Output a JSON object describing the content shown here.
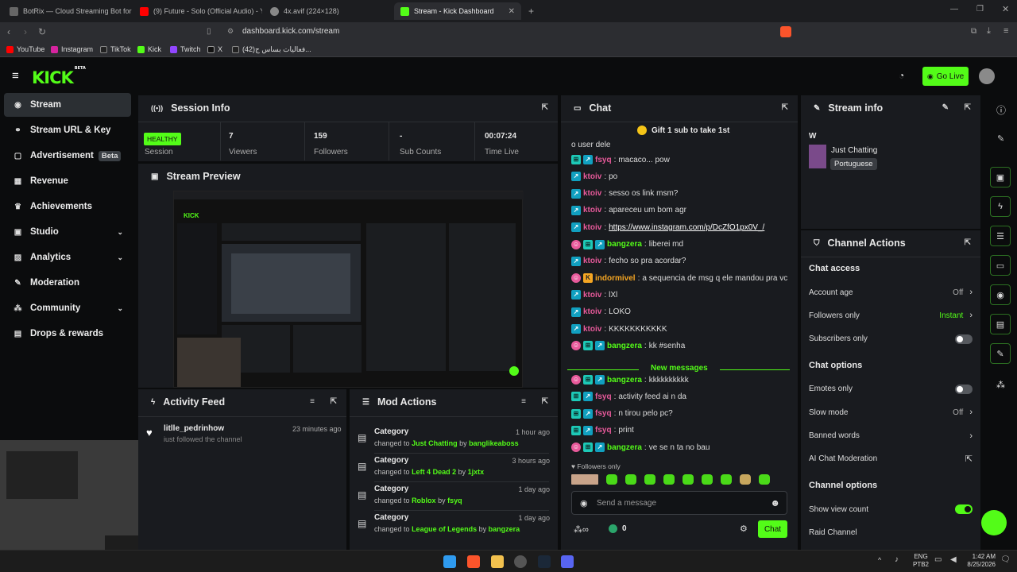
{
  "browser": {
    "tabs": [
      {
        "title": "BotRix — Cloud Streaming Bot for Tw",
        "color": "#666"
      },
      {
        "title": "(9) Future - Solo (Official Audio) - Yo",
        "color": "#ff0000"
      },
      {
        "title": "4x.avif (224×128)",
        "color": "#888"
      },
      {
        "title": "Stream - Kick Dashboard",
        "color": "#53fc18"
      }
    ],
    "url": "dashboard.kick.com/stream",
    "bookmarks": [
      "YouTube",
      "Instagram",
      "TikTok",
      "Kick",
      "Twitch",
      "X",
      "(42)فعاليات بساس ج..."
    ]
  },
  "header": {
    "logo": "KICK",
    "logo_sup": "BETA",
    "go_live": "Go Live"
  },
  "sidebar": {
    "items": [
      {
        "label": "Stream",
        "icon": "broadcast-icon",
        "active": true
      },
      {
        "label": "Stream URL & Key",
        "icon": "link-icon"
      },
      {
        "label": "Advertisement",
        "icon": "ad-icon",
        "badge": "Beta"
      },
      {
        "label": "Revenue",
        "icon": "revenue-icon"
      },
      {
        "label": "Achievements",
        "icon": "trophy-icon"
      },
      {
        "label": "Studio",
        "icon": "studio-icon",
        "chevron": true
      },
      {
        "label": "Analytics",
        "icon": "analytics-icon",
        "chevron": true
      },
      {
        "label": "Moderation",
        "icon": "wrench-icon"
      },
      {
        "label": "Community",
        "icon": "community-icon",
        "chevron": true
      },
      {
        "label": "Drops & rewards",
        "icon": "gift-icon"
      }
    ]
  },
  "session": {
    "title": "Session Info",
    "health": "HEALTHY",
    "stats": [
      {
        "label": "Session",
        "value": ""
      },
      {
        "label": "Viewers",
        "value": "7"
      },
      {
        "label": "Followers",
        "value": "159"
      },
      {
        "label": "Sub Counts",
        "value": "-"
      },
      {
        "label": "Time Live",
        "value": "00:07:24"
      }
    ]
  },
  "preview": {
    "title": "Stream Preview"
  },
  "activity": {
    "title": "Activity Feed",
    "items": [
      {
        "user": "litlle_pedrinhow",
        "time": "23 minutes ago",
        "text": "just followed the channel"
      }
    ]
  },
  "mod_actions": {
    "title": "Mod Actions",
    "items": [
      {
        "title": "Category",
        "time": "1 hour ago",
        "prefix": "changed to",
        "value": "Just Chatting",
        "by": "by",
        "user": "banglikeaboss"
      },
      {
        "title": "Category",
        "time": "3 hours ago",
        "prefix": "changed to",
        "value": "Left 4 Dead 2",
        "by": "by",
        "user": "1jxtx"
      },
      {
        "title": "Category",
        "time": "1 day ago",
        "prefix": "changed to",
        "value": "Roblox",
        "by": "by",
        "user": "fsyq"
      },
      {
        "title": "Category",
        "time": "1 day ago",
        "prefix": "changed to",
        "value": "League of Legends",
        "by": "by",
        "user": "bangzera"
      }
    ]
  },
  "chat": {
    "title": "Chat",
    "gift_banner": "Gift 1 sub to take 1st",
    "first_line": "o user dele",
    "messages": [
      {
        "user": "fsyq",
        "color": "#e85a9b",
        "badges": [
          "id",
          "sub"
        ],
        "text": "macaco... pow"
      },
      {
        "user": "ktoiv",
        "color": "#e85a9b",
        "badges": [
          "sub"
        ],
        "text": "po"
      },
      {
        "user": "ktoiv",
        "color": "#e85a9b",
        "badges": [
          "sub"
        ],
        "text": "sesso os link msm?"
      },
      {
        "user": "ktoiv",
        "color": "#e85a9b",
        "badges": [
          "sub"
        ],
        "text": "apareceu um bom agr"
      },
      {
        "user": "ktoiv",
        "color": "#e85a9b",
        "badges": [
          "sub"
        ],
        "text": "https://www.instagram.com/p/DcZfO1px0V_/",
        "link": true
      },
      {
        "user": "bangzera",
        "color": "#53fc18",
        "badges": [
          "vip",
          "id",
          "sub"
        ],
        "text": "liberei md"
      },
      {
        "user": "ktoiv",
        "color": "#e85a9b",
        "badges": [
          "sub"
        ],
        "text": "fecho so pra acordar?"
      },
      {
        "user": "indormivel",
        "color": "#f5a623",
        "badges": [
          "vip",
          "or"
        ],
        "text": "a sequencia de msg q ele mandou pra vc"
      },
      {
        "user": "ktoiv",
        "color": "#e85a9b",
        "badges": [
          "sub"
        ],
        "text": "lXl"
      },
      {
        "user": "ktoiv",
        "color": "#e85a9b",
        "badges": [
          "sub"
        ],
        "text": "LOKO"
      },
      {
        "user": "ktoiv",
        "color": "#e85a9b",
        "badges": [
          "sub"
        ],
        "text": "KKKKKKKKKKK"
      },
      {
        "user": "bangzera",
        "color": "#53fc18",
        "badges": [
          "vip",
          "id",
          "sub"
        ],
        "text": "kk #senha"
      }
    ],
    "new_messages": "New messages",
    "new": [
      {
        "user": "bangzera",
        "color": "#53fc18",
        "badges": [
          "vip",
          "id",
          "sub"
        ],
        "text": "kkkkkkkkkk"
      },
      {
        "user": "fsyq",
        "color": "#e85a9b",
        "badges": [
          "id",
          "sub"
        ],
        "text": "activity feed ai n da"
      },
      {
        "user": "fsyq",
        "color": "#e85a9b",
        "badges": [
          "id",
          "sub"
        ],
        "text": "n tirou pelo pc?"
      },
      {
        "user": "fsyq",
        "color": "#e85a9b",
        "badges": [
          "id",
          "sub"
        ],
        "text": "print"
      },
      {
        "user": "bangzera",
        "color": "#53fc18",
        "badges": [
          "vip",
          "id",
          "sub"
        ],
        "text": "ve se n ta no bau"
      }
    ],
    "followers_only": "Followers only",
    "placeholder": "Send a message",
    "points": "0",
    "send": "Chat"
  },
  "stream_info": {
    "title": "Stream info",
    "stream_title": "W",
    "category": "Just Chatting",
    "tag": "Portuguese"
  },
  "channel_actions": {
    "title": "Channel Actions",
    "sections": [
      {
        "heading": "Chat access",
        "rows": [
          {
            "label": "Account age",
            "value": "Off",
            "kind": "chev"
          },
          {
            "label": "Followers only",
            "value": "Instant",
            "kind": "chev",
            "accent": true
          },
          {
            "label": "Subscribers only",
            "kind": "toggle",
            "on": false
          }
        ]
      },
      {
        "heading": "Chat options",
        "rows": [
          {
            "label": "Emotes only",
            "kind": "toggle",
            "on": false
          },
          {
            "label": "Slow mode",
            "value": "Off",
            "kind": "chev"
          },
          {
            "label": "Banned words",
            "kind": "chev"
          },
          {
            "label": "AI Chat Moderation",
            "kind": "ext"
          }
        ]
      },
      {
        "heading": "Channel options",
        "rows": [
          {
            "label": "Show view count",
            "kind": "toggle",
            "on": true
          },
          {
            "label": "Raid Channel",
            "kind": "none"
          }
        ]
      }
    ]
  },
  "taskbar": {
    "lang": "ENG",
    "layout": "PTB2",
    "time": "1:42 AM",
    "date": "8/25/2026"
  },
  "colors": {
    "accent": "#53fc18",
    "panel": "#191b1f",
    "bg": "#0b0c0d"
  }
}
